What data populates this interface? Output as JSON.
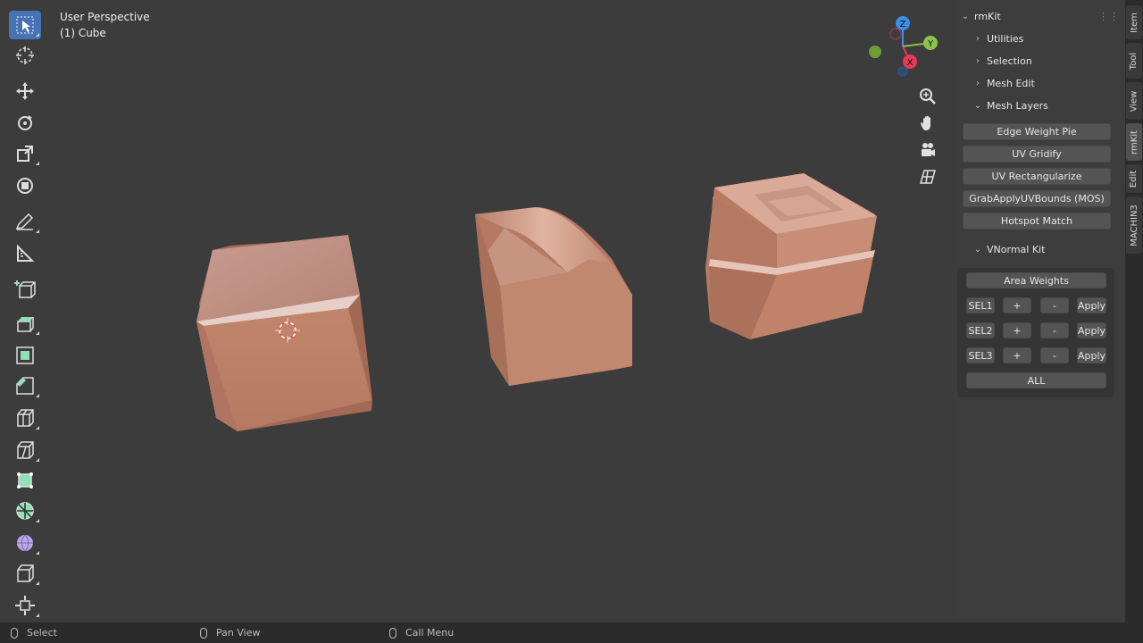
{
  "viewport": {
    "title": "User Perspective",
    "object": "(1) Cube"
  },
  "toolbar": {
    "tools": [
      {
        "name": "select-box-icon",
        "active": true
      },
      {
        "name": "cursor-icon"
      },
      {
        "name": "move-icon"
      },
      {
        "name": "rotate-icon"
      },
      {
        "name": "scale-icon"
      },
      {
        "name": "transform-icon"
      },
      {
        "name": "annotate-icon"
      },
      {
        "name": "measure-icon"
      },
      {
        "name": "add-cube-icon"
      },
      {
        "name": "extrude-icon"
      },
      {
        "name": "inset-icon"
      },
      {
        "name": "bevel-icon"
      },
      {
        "name": "loop-cut-icon"
      },
      {
        "name": "knife-icon"
      },
      {
        "name": "poly-build-icon"
      },
      {
        "name": "spin-icon"
      },
      {
        "name": "smooth-icon"
      },
      {
        "name": "edge-slide-icon"
      },
      {
        "name": "shrink-fatten-icon"
      }
    ]
  },
  "gizmo": {
    "x": "X",
    "y": "Y",
    "z": "Z"
  },
  "sidebar": {
    "title": "rmKit",
    "sections": [
      "Utilities",
      "Selection",
      "Mesh Edit",
      "Mesh Layers"
    ],
    "mesh_layer_buttons": [
      "Edge Weight Pie",
      "UV Gridify",
      "UV Rectangularize",
      "GrabApplyUVBounds (MOS)",
      "Hotspot Match"
    ],
    "vnormal": {
      "title": "VNormal Kit",
      "area_weights": "Area Weights",
      "rows": [
        {
          "sel": "SEL1",
          "plus": "+",
          "minus": "-",
          "apply": "Apply"
        },
        {
          "sel": "SEL2",
          "plus": "+",
          "minus": "-",
          "apply": "Apply"
        },
        {
          "sel": "SEL3",
          "plus": "+",
          "minus": "-",
          "apply": "Apply"
        }
      ],
      "all": "ALL"
    }
  },
  "tabs": [
    "Item",
    "Tool",
    "View",
    "rmKit",
    "Edit",
    "MACHIN3"
  ],
  "statusbar": {
    "select": "Select",
    "pan": "Pan View",
    "menu": "Call Menu"
  },
  "colors": {
    "accent": "#4772b3",
    "copper": "#c8866a",
    "x_axis": "#e8395a",
    "y_axis": "#8bc34a",
    "z_axis": "#3b8ee8"
  }
}
